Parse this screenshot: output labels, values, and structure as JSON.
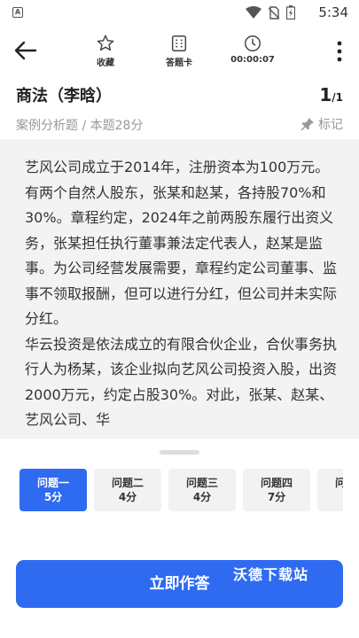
{
  "status_bar": {
    "time": "5:34",
    "app_badge": "A"
  },
  "toolbar": {
    "collect_label": "收藏",
    "answer_card_label": "答题卡",
    "timer": "00:00:07"
  },
  "header": {
    "title": "商法（李晗）",
    "page_current": "1",
    "page_total": "/1",
    "subtitle": "案例分析题 / 本题28分",
    "mark_label": "标记"
  },
  "content": {
    "paragraphs": [
      "艺风公司成立于2014年，注册资本为100万元。有两个自然人股东，张某和赵某，各持股70%和30%。章程约定，2024年之前两股东履行出资义务，张某担任执行董事兼法定代表人，赵某是监事。为公司经营发展需要，章程约定公司董事、监事不领取报酬，但可以进行分红，但公司并未实际分红。",
      "华云投资是依法成立的有限合伙企业，合伙事务执行人为杨某，该企业拟向艺风公司投资入股，出资2000万元，约定占股30%。对此，张某、赵某、艺风公司、华"
    ]
  },
  "questions": [
    {
      "name": "问题一",
      "score": "5分"
    },
    {
      "name": "问题二",
      "score": "4分"
    },
    {
      "name": "问题三",
      "score": "4分"
    },
    {
      "name": "问题四",
      "score": "7分"
    },
    {
      "name": "问题五",
      "score": ""
    }
  ],
  "submit_label": "立即作答",
  "watermark": "沃德下载站",
  "colors": {
    "accent": "#2f6bf0",
    "content_bg": "#f3f3f3"
  },
  "icons": [
    "back-arrow-icon",
    "star-icon",
    "answer-card-icon",
    "clock-icon",
    "more-icon",
    "pin-icon",
    "wifi-icon",
    "no-sim-icon",
    "battery-icon"
  ]
}
